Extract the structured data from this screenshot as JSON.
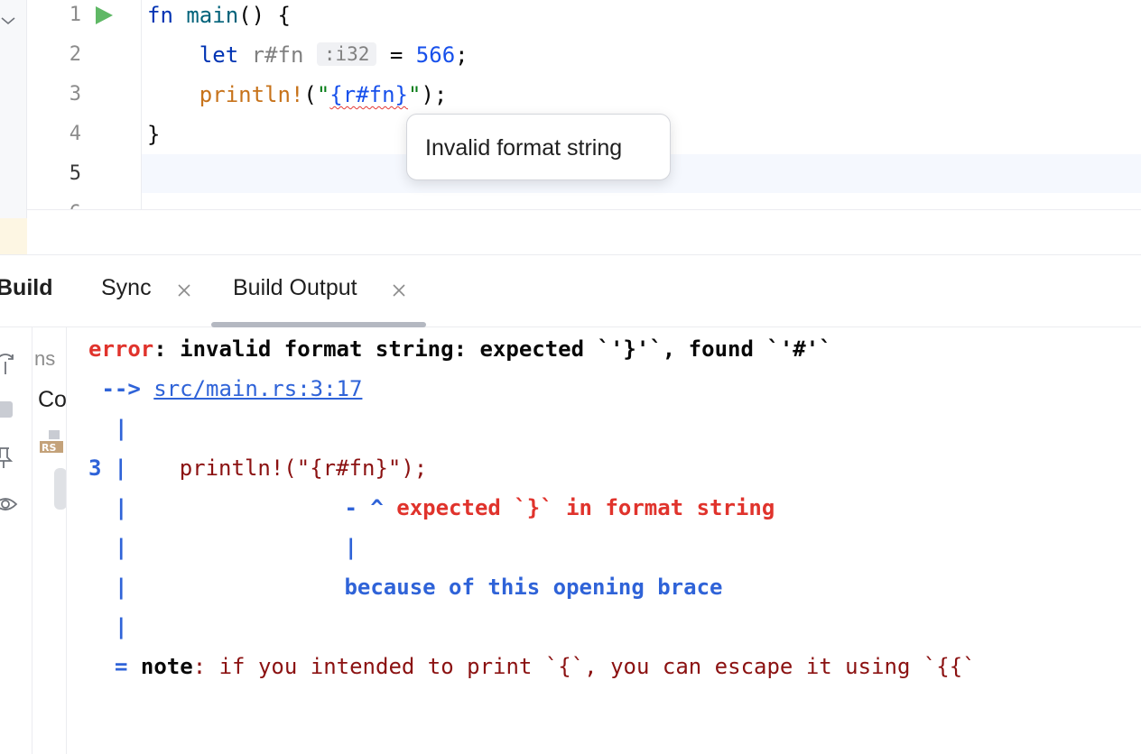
{
  "editor": {
    "line_numbers": [
      "1",
      "2",
      "3",
      "4",
      "5"
    ],
    "lines": {
      "l1": {
        "kw": "fn",
        "name": "main",
        "rest": "() {"
      },
      "l2": {
        "indent": "    ",
        "kw": "let",
        "var": " r#fn",
        "type_hint": ":i32",
        "eq": " = ",
        "num": "566",
        "end": ";"
      },
      "l3": {
        "indent": "    ",
        "macro": "println!",
        "open": "(",
        "q1": "\"",
        "tpl": "{r#fn}",
        "q2": "\"",
        "close": ");"
      },
      "l4": {
        "text": "}"
      }
    },
    "tooltip": "Invalid format string"
  },
  "tool_window": {
    "title": "Build",
    "tabs": [
      {
        "label": "Sync"
      },
      {
        "label": "Build Output"
      }
    ],
    "tree": {
      "item1": "ns",
      "item2": "Co",
      "rs_badge": "RS"
    },
    "output": {
      "error_word": "error",
      "error_msg": ": invalid format string: expected `'}'`, found `'#'`",
      "arrow": " --> ",
      "location": "src/main.rs:3:17",
      "pipe": "|",
      "line_no": "3",
      "code_line": "    println!(\"{r#fn}\");",
      "caret_prefix": "- ^ ",
      "caret_msg": "expected `}` in format string",
      "sub_pipe": "|",
      "because": "because of this opening brace",
      "note_eq": "= ",
      "note_word": "note",
      "note_msg": ": if you intended to print `{`, you can escape it using `{{`"
    }
  },
  "colors": {
    "accent": "#3574f0",
    "error_red": "#e0332c",
    "note_blue": "#2f63d8",
    "dark_red": "#8b1111"
  }
}
